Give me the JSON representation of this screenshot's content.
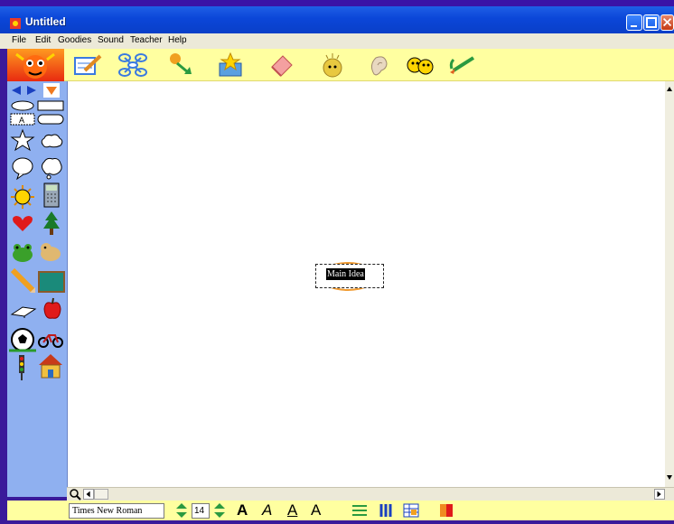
{
  "window": {
    "title": "Untitled"
  },
  "menu": [
    "File",
    "Edit",
    "Goodies",
    "Sound",
    "Teacher",
    "Help"
  ],
  "toolbar": {
    "icons": [
      "notes-icon",
      "diagram-icon",
      "arrow-link-icon",
      "symbol-box-icon",
      "eraser-icon",
      "idea-icon",
      "listen-icon",
      "teacher-icon",
      "paintbrush-icon"
    ]
  },
  "canvas": {
    "node": {
      "label": "Main Idea"
    }
  },
  "bottom": {
    "font": "Times New Roman",
    "size": "14",
    "bold_label": "A",
    "italic_label": "A",
    "underline_label": "A",
    "style_label": "A"
  },
  "colors": {
    "toolbar_bg": "#ffffa0",
    "sidebar_bg": "#8fb0f0",
    "title_bar": "#0b46d8",
    "node_outline": "#f09a30"
  }
}
